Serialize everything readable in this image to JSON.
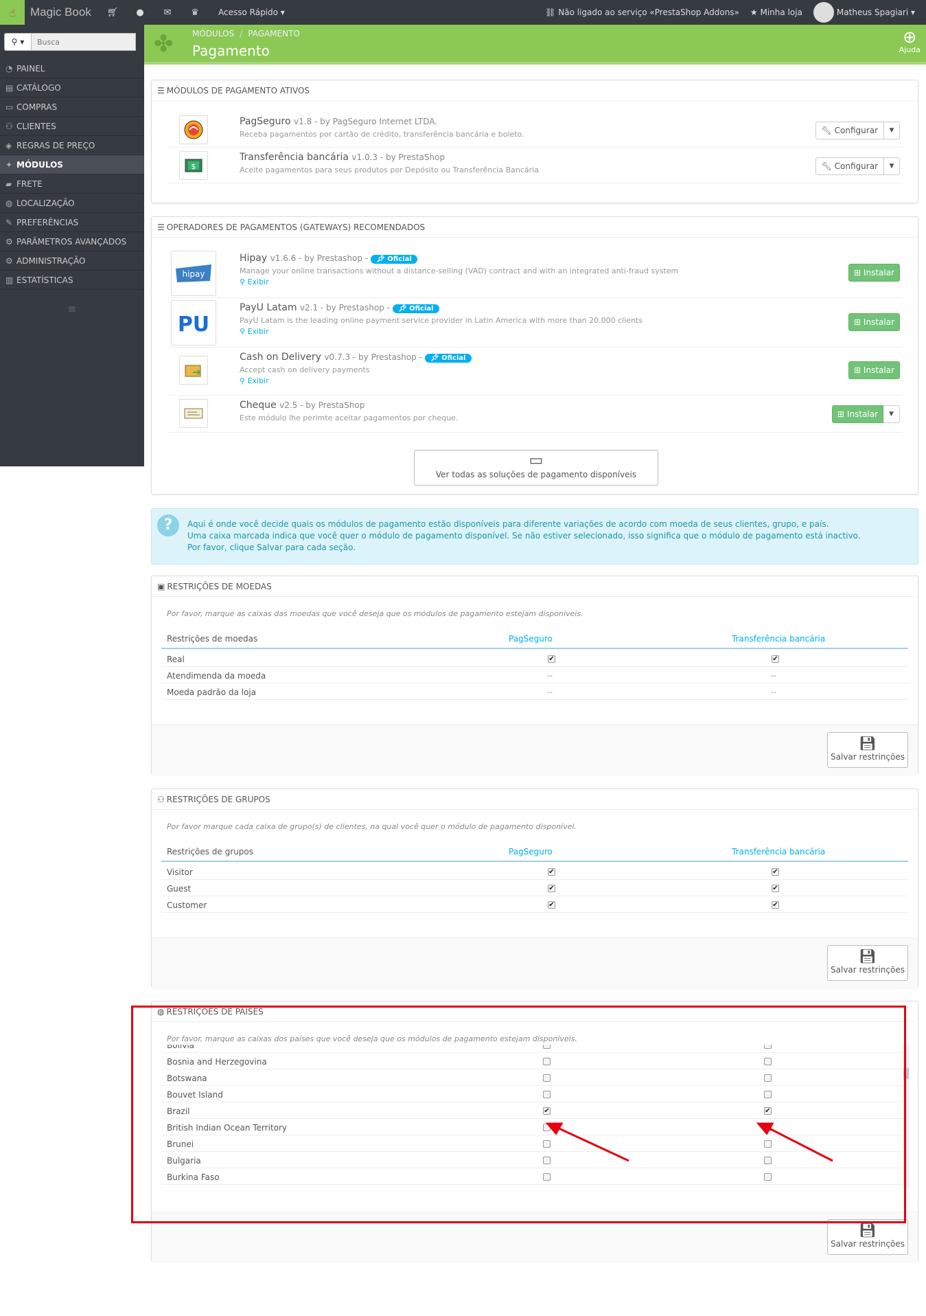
{
  "topbar": {
    "brand": "Magic Book",
    "quick_access": "Acesso Rápido ▾",
    "addons_status": "Não ligado ao serviço «PrestaShop Addons»",
    "my_store": "Minha loja",
    "user": "Matheus Spagiari ▾"
  },
  "sidebar": {
    "search_mode": "⚲ ▾",
    "search_placeholder": "Busca",
    "items": [
      {
        "label": "PAINEL",
        "icon": "◔"
      },
      {
        "label": "CATÁLOGO",
        "icon": "▤"
      },
      {
        "label": "COMPRAS",
        "icon": "▭"
      },
      {
        "label": "CLIENTES",
        "icon": "⚇"
      },
      {
        "label": "REGRAS DE PREÇO",
        "icon": "◈"
      },
      {
        "label": "MÓDULOS",
        "icon": "✦"
      },
      {
        "label": "FRETE",
        "icon": "▰"
      },
      {
        "label": "LOCALIZAÇÃO",
        "icon": "◍"
      },
      {
        "label": "PREFERÊNCIAS",
        "icon": "✎"
      },
      {
        "label": "PARÂMETROS AVANÇADOS",
        "icon": "⚙"
      },
      {
        "label": "ADMINISTRAÇÃO",
        "icon": "⚙"
      },
      {
        "label": "ESTATÍSTICAS",
        "icon": "▥"
      }
    ],
    "active_index": 5
  },
  "header": {
    "breadcrumb_1": "MÓDULOS",
    "breadcrumb_2": "PAGAMENTO",
    "title": "Pagamento",
    "help": "Ajuda"
  },
  "active_modules": {
    "title": "MÓDULOS DE PAGAMENTO ATIVOS",
    "items": [
      {
        "name": "PagSeguro",
        "meta": "v1.8 - by PagSeguro Internet LTDA.",
        "desc": "Receba pagamentos por cartão de crédito, transferência bancária e boleto.",
        "button": "Configurar"
      },
      {
        "name": "Transferência bancária",
        "meta": "v1.0.3 - by PrestaShop",
        "desc": "Aceite pagamentos para seus produtos por Depósito ou Transferência Bancária",
        "button": "Configurar"
      }
    ]
  },
  "gateways": {
    "title": "OPERADORES DE PAGAMENTOS (GATEWAYS) RECOMENDADOS",
    "items": [
      {
        "name": "Hipay",
        "meta": "v1.6.6 - by Prestashop -",
        "badge": "Oficial",
        "desc": "Manage your online transactions without a distance-selling (VAD) contract and with an integrated anti-fraud system",
        "link": "Exibir",
        "button": "Instalar"
      },
      {
        "name": "PayU Latam",
        "meta": "v2.1 - by Prestashop -",
        "badge": "Oficial",
        "desc": "PayU Latam is the leading online payment service provider in Latin America with more than 20,000 clients",
        "link": "Exibir",
        "button": "Instalar"
      },
      {
        "name": "Cash on Delivery",
        "meta": "v0.7.3 - by Prestashop -",
        "badge": "Oficial",
        "desc": "Accept cash on delivery payments",
        "link": "Exibir",
        "button": "Instalar"
      },
      {
        "name": "Cheque",
        "meta": "v2.5 - by PrestaShop",
        "desc": "Este módulo lhe perimte aceitar pagamentos por cheque.",
        "button": "Instalar"
      }
    ],
    "view_all": "Ver todas as soluções de pagamento disponíveis"
  },
  "info": {
    "line1": "Aqui é onde você decide quais os módulos de pagamento estão disponíveis para diferente variações de acordo com moeda de seus clientes, grupo, e país.",
    "line2": "Uma caixa marcada indica que você quer o módulo de pagamento disponível. Se não estiver selecionado, isso significa que o módulo de pagamento está inactivo.",
    "line3": "Por favor, clique Salvar para cada seção."
  },
  "currency": {
    "title": "RESTRIÇÕES DE MOEDAS",
    "desc": "Por favor, marque as caixas das moedas que você deseja que os módulos de pagamento estejam disponíveis.",
    "col0": "Restrições de moedas",
    "col1": "PagSeguro",
    "col2": "Transferência bancária",
    "rows": [
      {
        "label": "Real",
        "c1": true,
        "c2": true
      },
      {
        "label": "Atendimenda da moeda",
        "c1": "--",
        "c2": "--"
      },
      {
        "label": "Moeda padrão da loja",
        "c1": "--",
        "c2": "--"
      }
    ],
    "save": "Salvar restrinções"
  },
  "groups": {
    "title": "RESTRIÇÕES DE GRUPOS",
    "desc": "Por favor marque cada caixa de grupo(s) de clientes, na qual você quer o módulo de pagamento disponível.",
    "col0": "Restrições de grupos",
    "col1": "PagSeguro",
    "col2": "Transferência bancária",
    "rows": [
      {
        "label": "Visitor",
        "c1": true,
        "c2": true
      },
      {
        "label": "Guest",
        "c1": true,
        "c2": true
      },
      {
        "label": "Customer",
        "c1": true,
        "c2": true
      }
    ],
    "save": "Salvar restrinções"
  },
  "countries": {
    "title": "RESTRIÇÕES DE PAÍSES",
    "desc": "Por favor, marque as caixas dos países que você deseja que os módulos de pagamento estejam disponíveis.",
    "rows": [
      {
        "label": "Bolivia",
        "c1": false,
        "c2": false
      },
      {
        "label": "Bosnia and Herzegovina",
        "c1": false,
        "c2": false
      },
      {
        "label": "Botswana",
        "c1": false,
        "c2": false
      },
      {
        "label": "Bouvet Island",
        "c1": false,
        "c2": false
      },
      {
        "label": "Brazil",
        "c1": true,
        "c2": true
      },
      {
        "label": "British Indian Ocean Territory",
        "c1": false,
        "c2": false
      },
      {
        "label": "Brunei",
        "c1": false,
        "c2": false
      },
      {
        "label": "Bulgaria",
        "c1": false,
        "c2": false
      },
      {
        "label": "Burkina Faso",
        "c1": false,
        "c2": false
      }
    ],
    "save": "Salvar restrinções"
  },
  "colors": {
    "accent": "#8bc954",
    "link": "#00aff0",
    "highlight": "#e50012",
    "install": "#72c279"
  }
}
